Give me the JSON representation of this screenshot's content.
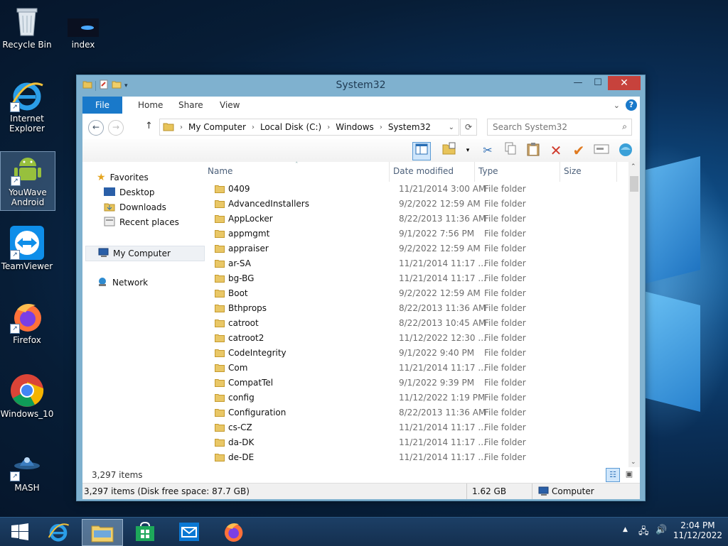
{
  "desktop": {
    "icons": [
      {
        "label": "Recycle Bin",
        "icon": "recycle-bin-icon"
      },
      {
        "label": "index",
        "icon": "file-thumbnail-icon"
      },
      {
        "label": "Internet Explorer",
        "icon": "internet-explorer-icon"
      },
      {
        "label": "YouWave Android",
        "icon": "android-icon"
      },
      {
        "label": "TeamViewer",
        "icon": "teamviewer-icon"
      },
      {
        "label": "Firefox",
        "icon": "firefox-icon"
      },
      {
        "label": "Windows_10",
        "icon": "chrome-icon"
      },
      {
        "label": "MASH",
        "icon": "mash-icon"
      }
    ]
  },
  "window": {
    "title": "System32",
    "close_glyph": "✕",
    "minimize_glyph": "—",
    "maximize_glyph": "☐",
    "ribbon_tabs": [
      {
        "label": "File"
      },
      {
        "label": "Home"
      },
      {
        "label": "Share"
      },
      {
        "label": "View"
      }
    ],
    "help_glyph": "?",
    "address": {
      "segments": [
        "My Computer",
        "Local Disk (C:)",
        "Windows",
        "System32"
      ]
    },
    "search": {
      "placeholder": "Search System32"
    },
    "nav": {
      "favorites": {
        "label": "Favorites",
        "items": [
          "Desktop",
          "Downloads",
          "Recent places"
        ]
      },
      "computer": "My Computer",
      "network": "Network"
    },
    "columns": {
      "name": "Name",
      "date": "Date modified",
      "type": "Type",
      "size": "Size"
    },
    "files": [
      {
        "name": "0409",
        "date": "11/21/2014 3:00 AM",
        "type": "File folder"
      },
      {
        "name": "AdvancedInstallers",
        "date": "9/2/2022 12:59 AM",
        "type": "File folder"
      },
      {
        "name": "AppLocker",
        "date": "8/22/2013 11:36 AM",
        "type": "File folder"
      },
      {
        "name": "appmgmt",
        "date": "9/1/2022 7:56 PM",
        "type": "File folder"
      },
      {
        "name": "appraiser",
        "date": "9/2/2022 12:59 AM",
        "type": "File folder"
      },
      {
        "name": "ar-SA",
        "date": "11/21/2014 11:17 ...",
        "type": "File folder"
      },
      {
        "name": "bg-BG",
        "date": "11/21/2014 11:17 ...",
        "type": "File folder"
      },
      {
        "name": "Boot",
        "date": "9/2/2022 12:59 AM",
        "type": "File folder"
      },
      {
        "name": "Bthprops",
        "date": "8/22/2013 11:36 AM",
        "type": "File folder"
      },
      {
        "name": "catroot",
        "date": "8/22/2013 10:45 AM",
        "type": "File folder"
      },
      {
        "name": "catroot2",
        "date": "11/12/2022 12:30 ...",
        "type": "File folder"
      },
      {
        "name": "CodeIntegrity",
        "date": "9/1/2022 9:40 PM",
        "type": "File folder"
      },
      {
        "name": "Com",
        "date": "11/21/2014 11:17 ...",
        "type": "File folder"
      },
      {
        "name": "CompatTel",
        "date": "9/1/2022 9:39 PM",
        "type": "File folder"
      },
      {
        "name": "config",
        "date": "11/12/2022 1:19 PM",
        "type": "File folder"
      },
      {
        "name": "Configuration",
        "date": "8/22/2013 11:36 AM",
        "type": "File folder"
      },
      {
        "name": "cs-CZ",
        "date": "11/21/2014 11:17 ...",
        "type": "File folder"
      },
      {
        "name": "da-DK",
        "date": "11/21/2014 11:17 ...",
        "type": "File folder"
      },
      {
        "name": "de-DE",
        "date": "11/21/2014 11:17 ...",
        "type": "File folder"
      }
    ],
    "item_count": "3,297 items",
    "status": {
      "left": "3,297 items (Disk free space: 87.7 GB)",
      "size": "1.62 GB",
      "location": "Computer"
    }
  },
  "taskbar": {
    "time": "2:04 PM",
    "date": "11/12/2022",
    "pinned": [
      "start-icon",
      "internet-explorer-icon",
      "file-explorer-icon",
      "store-icon",
      "mail-icon",
      "firefox-icon"
    ]
  }
}
